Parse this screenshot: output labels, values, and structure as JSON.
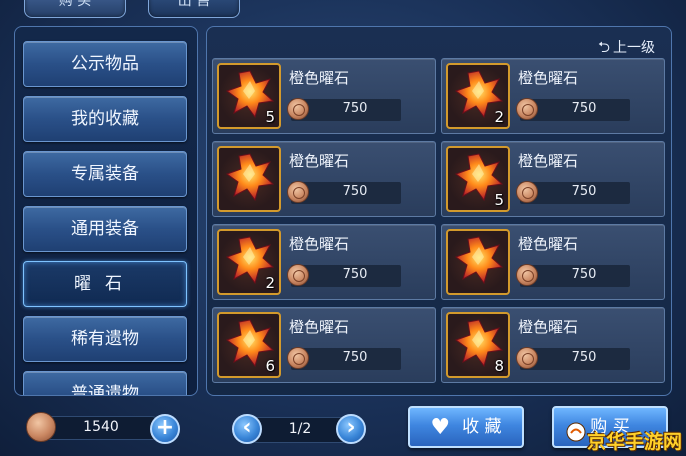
{
  "tabs": {
    "buy": "购 买",
    "sell": "出 售"
  },
  "sidebar": {
    "items": [
      {
        "label": "公示物品"
      },
      {
        "label": "我的收藏"
      },
      {
        "label": "专属装备"
      },
      {
        "label": "通用装备"
      },
      {
        "label": "曜石",
        "selected": true
      },
      {
        "label": "稀有遗物"
      },
      {
        "label": "普通遗物"
      }
    ]
  },
  "main": {
    "back_label": "上一级",
    "items": [
      {
        "name": "橙色曜石",
        "price": "750",
        "count": "5"
      },
      {
        "name": "橙色曜石",
        "price": "750",
        "count": "2"
      },
      {
        "name": "橙色曜石",
        "price": "750",
        "count": ""
      },
      {
        "name": "橙色曜石",
        "price": "750",
        "count": "5"
      },
      {
        "name": "橙色曜石",
        "price": "750",
        "count": "2"
      },
      {
        "name": "橙色曜石",
        "price": "750",
        "count": ""
      },
      {
        "name": "橙色曜石",
        "price": "750",
        "count": "6"
      },
      {
        "name": "橙色曜石",
        "price": "750",
        "count": "8"
      }
    ]
  },
  "footer": {
    "currency": "1540",
    "page": "1/2",
    "favorite_label": "收 藏",
    "buy_label": "购 买",
    "watermark": "京华手游网"
  },
  "colors": {
    "accent_blue": "#3f86e0",
    "frame_gold": "#d39a2c",
    "watermark": "#ffd02a"
  },
  "icons": {
    "coin": "copper-coin-icon",
    "gem": "orange-obsidian-gem-icon",
    "back": "back-arrow-icon",
    "favorite": "heart-icon"
  }
}
